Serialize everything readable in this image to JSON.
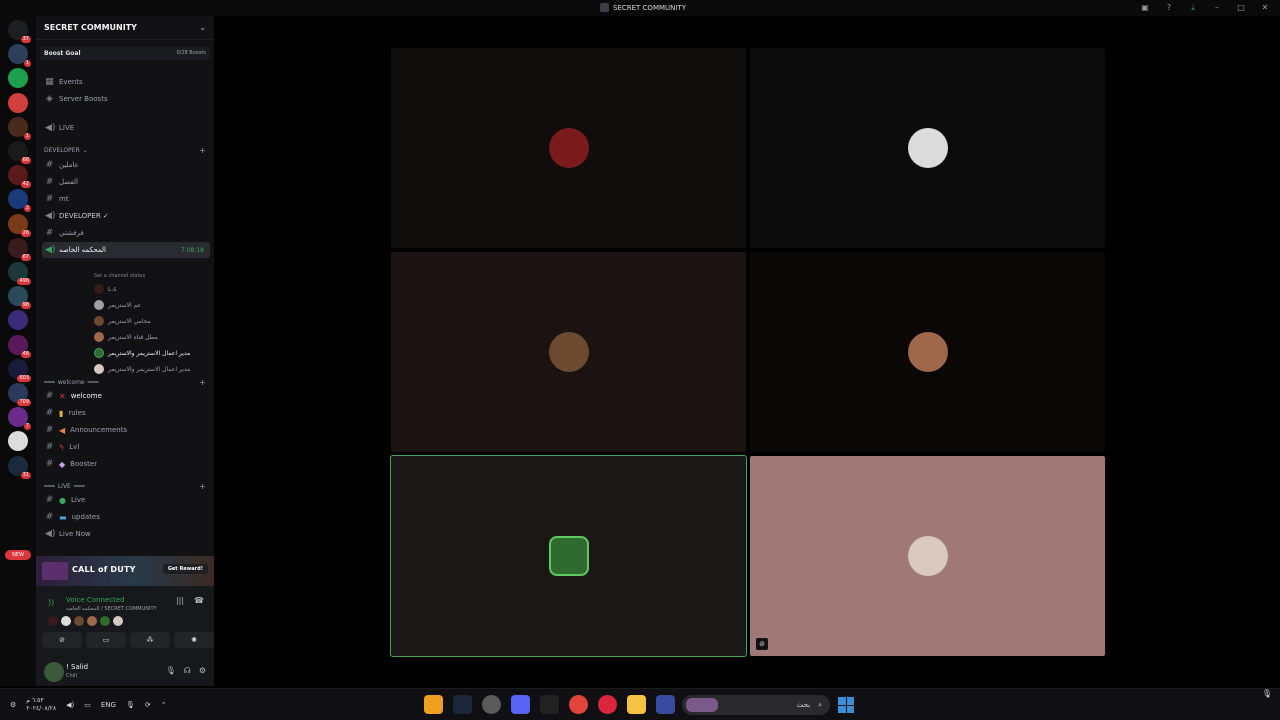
{
  "window": {
    "title": "SECRET COMMUNITY"
  },
  "guilds": [
    {
      "color": "#1e1f22",
      "badge": "37"
    },
    {
      "color": "#2e3f5c",
      "badge": "1"
    },
    {
      "color": "#1d9f4e",
      "badge": ""
    },
    {
      "color": "#d13f3f",
      "badge": ""
    },
    {
      "color": "#4a2a1a",
      "badge": "1"
    },
    {
      "color": "#1a1a1a",
      "badge": "68"
    },
    {
      "color": "#5a1a1a",
      "badge": "42"
    },
    {
      "color": "#1a3a7a",
      "badge": "2"
    },
    {
      "color": "#7a3a1a",
      "badge": "26"
    },
    {
      "color": "#3a1a1a",
      "badge": "67"
    },
    {
      "color": "#1a3a3a",
      "badge": "496"
    },
    {
      "color": "#2a4a5a",
      "badge": "98"
    },
    {
      "color": "#3a2a7a",
      "badge": ""
    },
    {
      "color": "#5a1a5a",
      "badge": "48"
    },
    {
      "color": "#1a1a3a",
      "badge": "603"
    },
    {
      "color": "#2a3a5a",
      "badge": "709"
    },
    {
      "color": "#6a2a8a",
      "badge": "7"
    },
    {
      "color": "#dddddd",
      "badge": ""
    },
    {
      "color": "#1a2a3a",
      "badge": "31"
    },
    {
      "color": "#0a0a0a",
      "badge": ""
    }
  ],
  "new_pill": "NEW",
  "sidebar": {
    "server_name": "SECRET COMMUNITY",
    "boost_goal_label": "Boost Goal",
    "boost_goal_count": "0/28 Boosts",
    "events": "Events",
    "server_boosts": "Server Boosts",
    "live_channel": "LIVE",
    "category_developer": "DEVELOPER",
    "ch_1": "عاملين",
    "ch_2": "الفصل",
    "ch_3": "mt",
    "ch_developer_voice": "DEVELOPER ✓",
    "ch_4": "فرفشتي",
    "active_voice_channel": "المحكمه الخاصه",
    "active_voice_timer": "7:08:18",
    "active_voice_status": "Set a channel status",
    "voice_users": [
      "L.s",
      "عم الاستريمر",
      "محامي الاستريمر",
      "مطل قناه الاستريمر",
      "مدير اعمال الاستريمر والاستريمر",
      "مدير اعمال الاستريمر والاستريمر"
    ],
    "category_welcome": "welcome",
    "ch_welcome": "welcome",
    "ch_rules": "rules",
    "ch_announcements": "Announcements",
    "ch_lvl": "Lvl",
    "ch_booster": "Booster",
    "category_live": "LIVE",
    "ch_live": "Live",
    "ch_updates": "updates",
    "ch_live_now": "Live Now"
  },
  "promo": {
    "title": "CALL of DUTY",
    "button": "Get Reward!"
  },
  "voice": {
    "connected_label": "Voice Connected",
    "channel_path": "المحكمه الخاصه / SECRET COMMUNITY"
  },
  "user": {
    "name": "! Salid",
    "status": "Chill"
  },
  "tiles": [
    {
      "bg": "#0f0e0c",
      "avatar": "#7a1a1a"
    },
    {
      "bg": "#0b0b0c",
      "avatar": "#dcdcdc"
    },
    {
      "bg": "#1a1311",
      "avatar": "#6b4a30"
    },
    {
      "bg": "#0b0707",
      "avatar": "#a0684a"
    },
    {
      "bg": "#191816",
      "avatar": "#2f6b2f"
    },
    {
      "bg": "#a07877",
      "avatar": "#d9c8c0"
    }
  ],
  "taskbar": {
    "time": "٦:٥٣ م",
    "date": "٢٠٢٤/٠٨/٢٨",
    "lang": "ENG",
    "search_placeholder": "بحث"
  },
  "colors": {
    "accent_green": "#3ba55c",
    "danger_red": "#da373c"
  }
}
